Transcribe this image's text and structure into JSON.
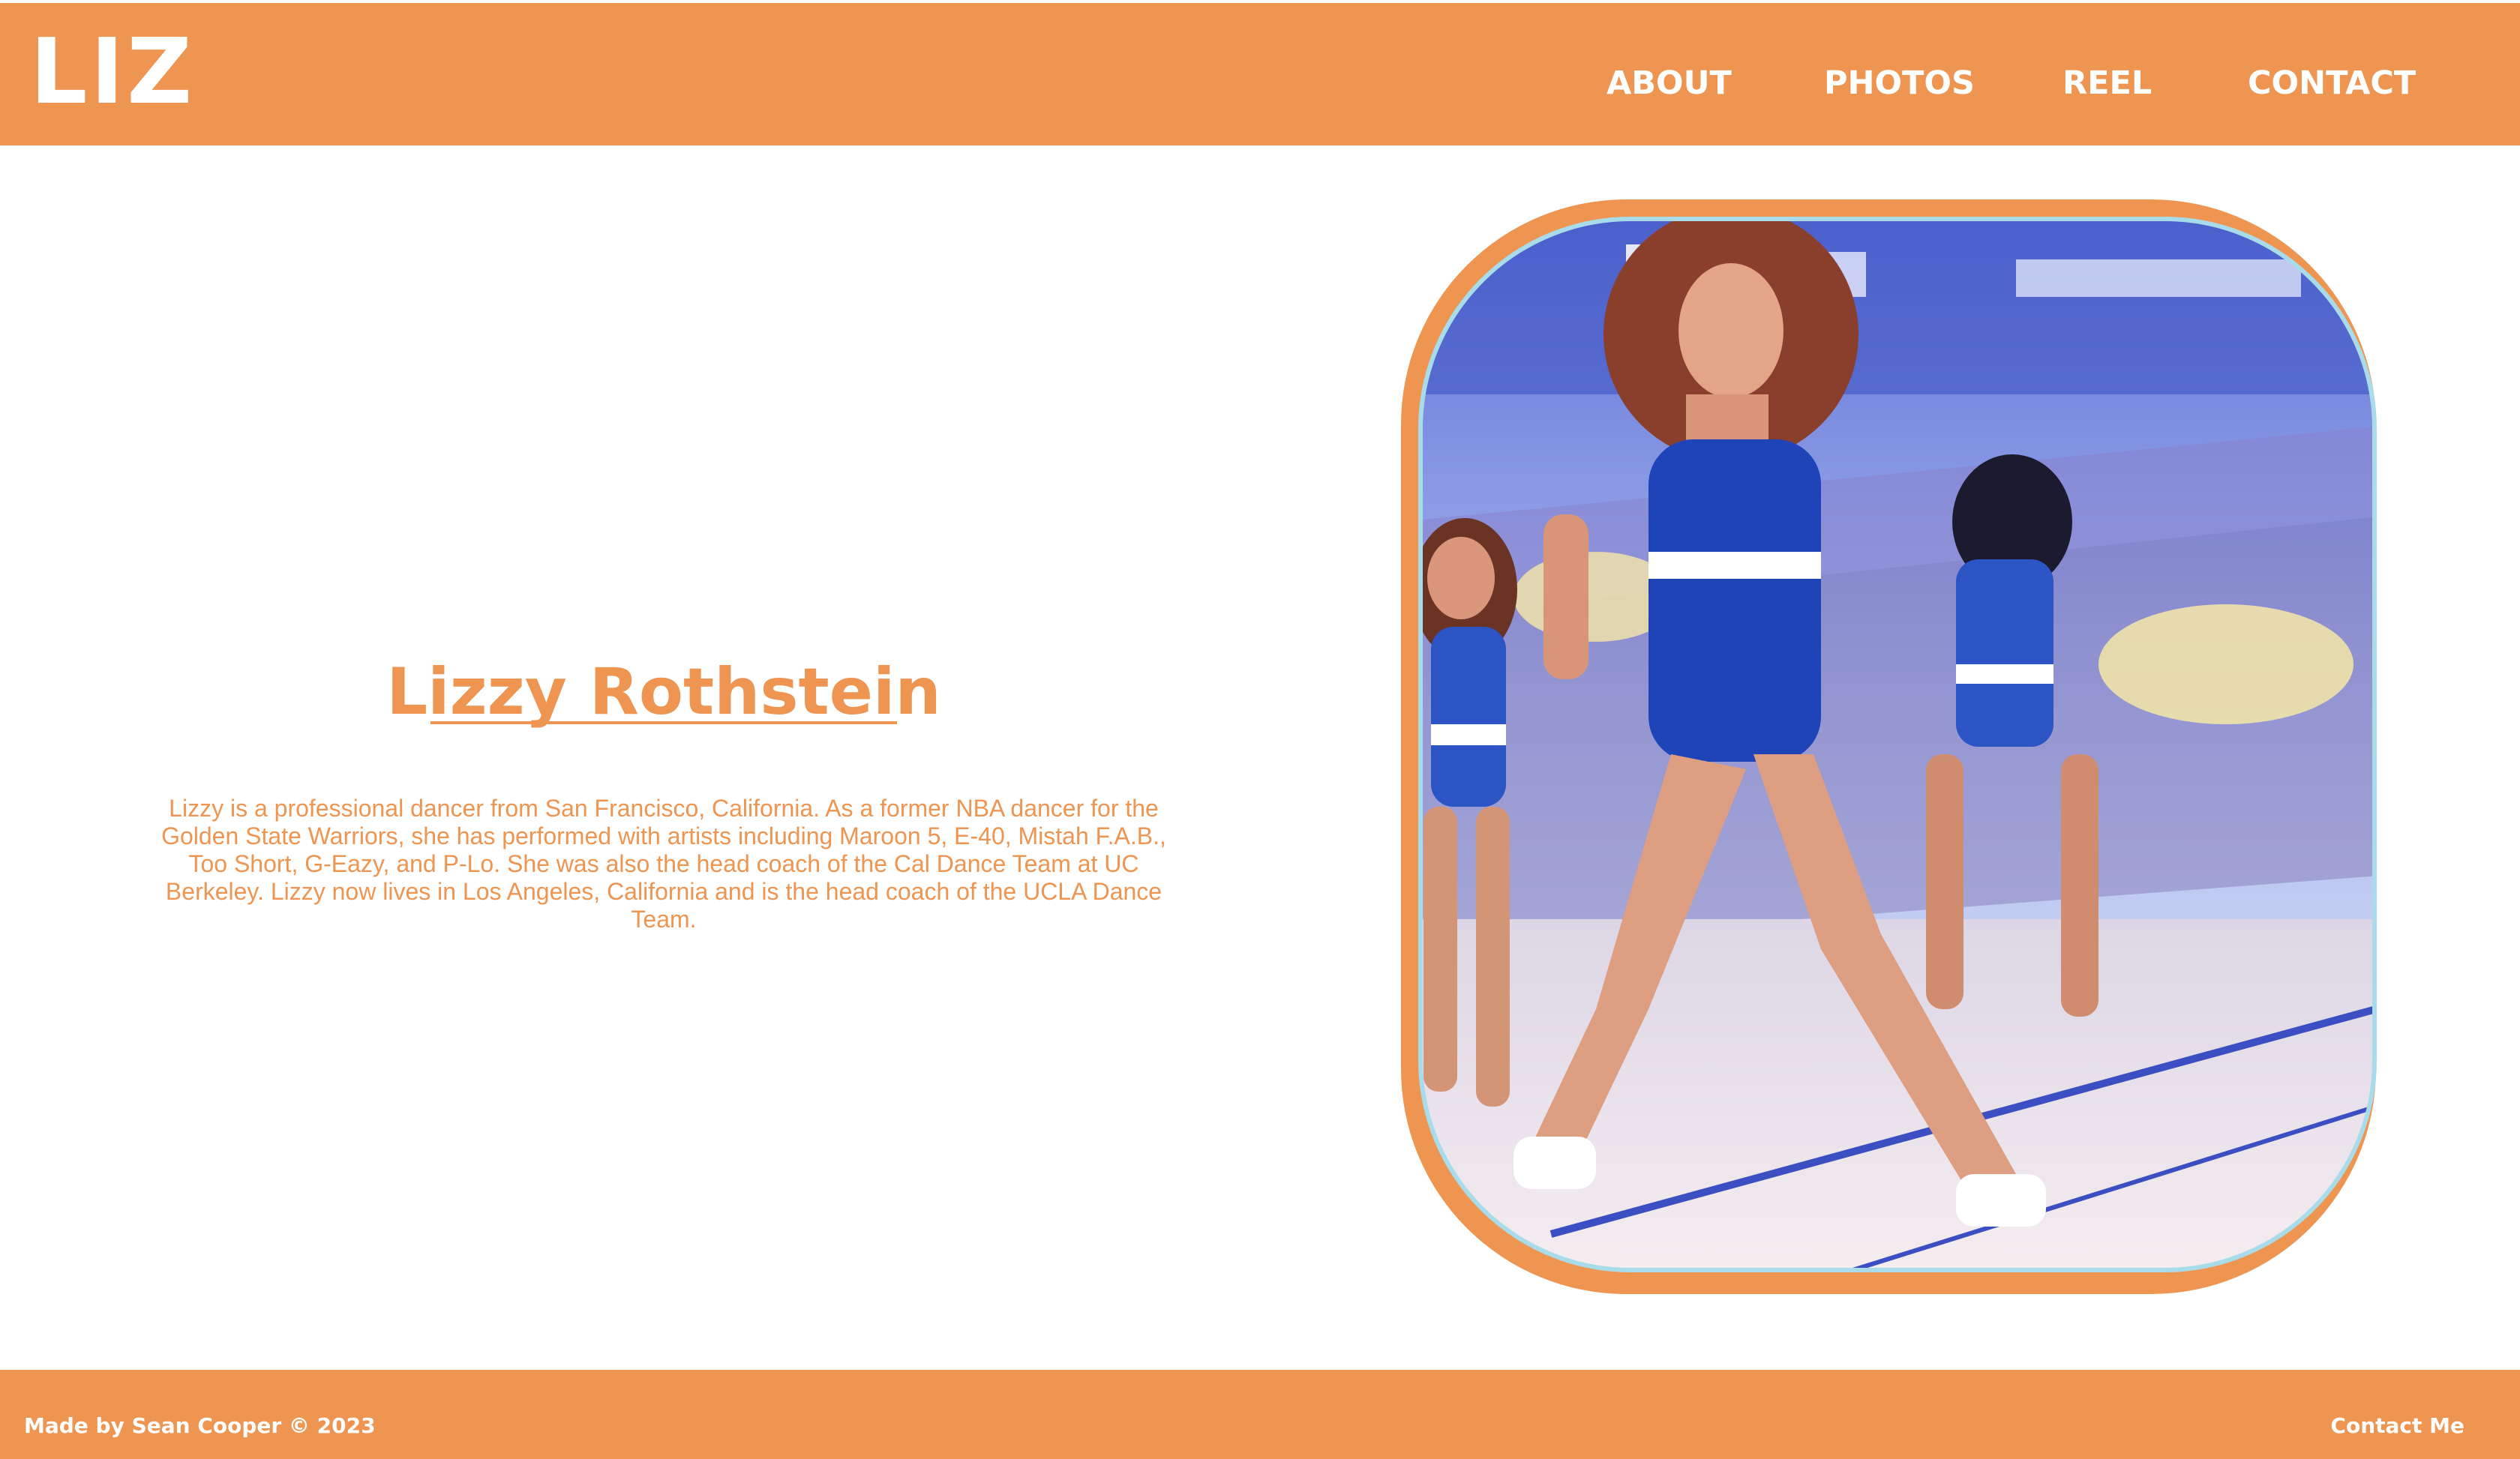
{
  "header": {
    "logo": "LIZ",
    "nav": [
      "ABOUT",
      "PHOTOS",
      "REEL",
      "CONTACT"
    ]
  },
  "hero": {
    "name": "Lizzy Rothstein",
    "bio": "Lizzy is a professional dancer from San Francisco, California. As a former NBA dancer for the Golden State Warriors, she has performed with artists including Maroon 5, E-40, Mistah F.A.B., Too Short, G-Eazy, and P-Lo. She was also the head coach of the Cal Dance Team at UC Berkeley. Lizzy now lives in Los Angeles, California and is the head coach of the UCLA Dance Team."
  },
  "footer": {
    "credit": "Made by Sean Cooper © 2023",
    "contact": "Contact Me"
  },
  "colors": {
    "accent": "#ef9552",
    "photo_border": "#a9dcea",
    "background": "#ffffff"
  }
}
